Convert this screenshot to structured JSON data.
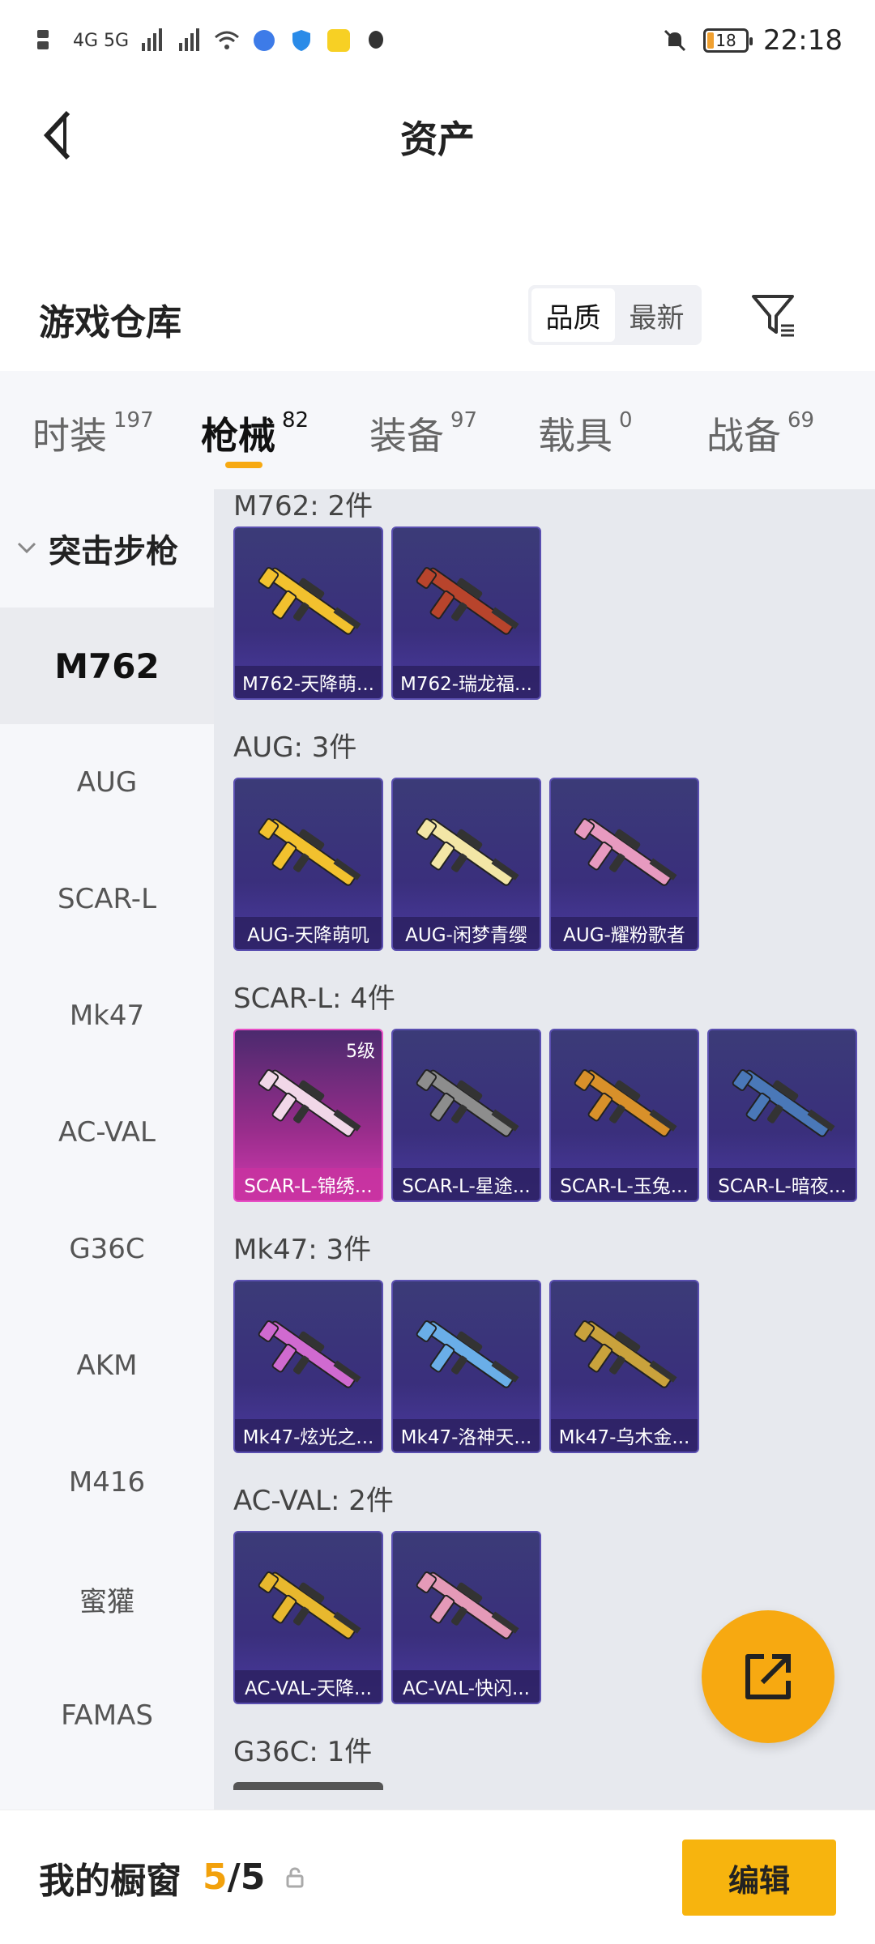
{
  "status_bar": {
    "network": "4G 5G",
    "battery": "18",
    "time": "22:18"
  },
  "header": {
    "title": "资产",
    "back_icon": "chevron-left-icon"
  },
  "warehouse": {
    "title": "游戏仓库",
    "sort_options": [
      "品质",
      "最新"
    ],
    "selected_sort": "品质",
    "filter_icon": "filter-icon"
  },
  "tabs": [
    {
      "label": "时装",
      "count": "197"
    },
    {
      "label": "枪械",
      "count": "82"
    },
    {
      "label": "装备",
      "count": "97"
    },
    {
      "label": "载具",
      "count": "0"
    },
    {
      "label": "战备",
      "count": "69"
    }
  ],
  "sidebar": {
    "group": "突击步枪",
    "items": [
      "M762",
      "AUG",
      "SCAR-L",
      "Mk47",
      "AC-VAL",
      "G36C",
      "AKM",
      "M416",
      "蜜獾",
      "FAMAS"
    ],
    "selected": "M762"
  },
  "sections": [
    {
      "title": "M762: 2件",
      "cards": [
        {
          "name": "M762-天降萌...",
          "color": "#f2c12e"
        },
        {
          "name": "M762-瑞龙福...",
          "color": "#b8442c"
        }
      ]
    },
    {
      "title": "AUG: 3件",
      "cards": [
        {
          "name": "AUG-天降萌叽",
          "color": "#f2c12e"
        },
        {
          "name": "AUG-闲梦青缨",
          "color": "#f3e6a6"
        },
        {
          "name": "AUG-耀粉歌者",
          "color": "#e79ac0"
        }
      ]
    },
    {
      "title": "SCAR-L: 4件",
      "cards": [
        {
          "name": "SCAR-L-锦绣...",
          "color": "#f1d7e8",
          "level": "5级"
        },
        {
          "name": "SCAR-L-星途...",
          "color": "#8d8d8d"
        },
        {
          "name": "SCAR-L-玉兔...",
          "color": "#d8902a"
        },
        {
          "name": "SCAR-L-暗夜...",
          "color": "#4a78b8"
        }
      ]
    },
    {
      "title": "Mk47: 3件",
      "cards": [
        {
          "name": "Mk47-炫光之...",
          "color": "#d06ad0"
        },
        {
          "name": "Mk47-洛神天...",
          "color": "#6aaee8"
        },
        {
          "name": "Mk47-乌木金...",
          "color": "#c9a23c"
        }
      ]
    },
    {
      "title": "AC-VAL: 2件",
      "cards": [
        {
          "name": "AC-VAL-天降...",
          "color": "#e8b82e"
        },
        {
          "name": "AC-VAL-快闪...",
          "color": "#e49ab8"
        }
      ]
    },
    {
      "title": "G36C: 1件",
      "cards": []
    }
  ],
  "bottom_bar": {
    "title": "我的橱窗",
    "current": "5",
    "separator": "/",
    "total": "5",
    "edit_label": "编辑"
  },
  "fab_icon": "share-icon"
}
